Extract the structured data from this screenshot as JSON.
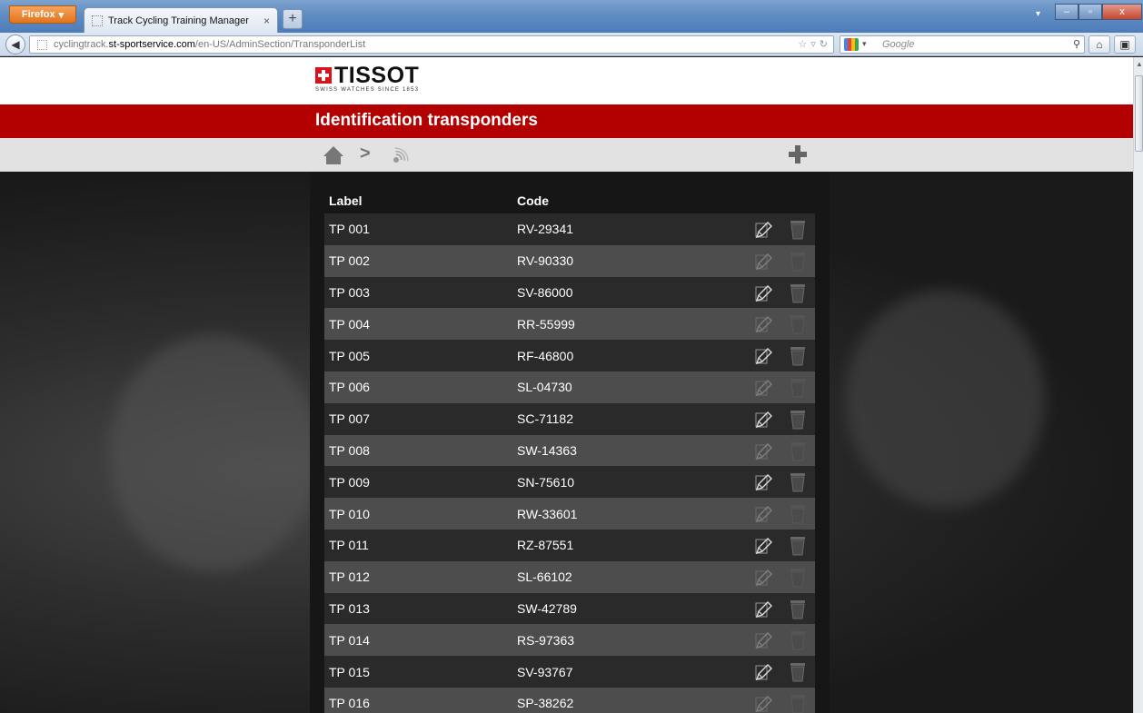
{
  "browser": {
    "app_button": "Firefox",
    "tab_title": "Track Cycling Training Manager",
    "new_tab": "+",
    "url_prefix": "cyclingtrack.",
    "url_host": "st-sportservice.com",
    "url_path": "/en-US/AdminSection/TransponderList",
    "search_placeholder": "Google",
    "window_min": "–",
    "window_max": "▫",
    "window_close": "x"
  },
  "header": {
    "logo_word": "TISSOT",
    "logo_tagline": "SWISS WATCHES SINCE 1853",
    "page_title": "Identification transponders",
    "breadcrumb_separator": ">"
  },
  "table": {
    "columns": {
      "label": "Label",
      "code": "Code"
    },
    "rows": [
      {
        "label": "TP 001",
        "code": "RV-29341"
      },
      {
        "label": "TP 002",
        "code": "RV-90330"
      },
      {
        "label": "TP 003",
        "code": "SV-86000"
      },
      {
        "label": "TP 004",
        "code": "RR-55999"
      },
      {
        "label": "TP 005",
        "code": "RF-46800"
      },
      {
        "label": "TP 006",
        "code": "SL-04730"
      },
      {
        "label": "TP 007",
        "code": "SC-71182"
      },
      {
        "label": "TP 008",
        "code": "SW-14363"
      },
      {
        "label": "TP 009",
        "code": "SN-75610"
      },
      {
        "label": "TP 010",
        "code": "RW-33601"
      },
      {
        "label": "TP 011",
        "code": "RZ-87551"
      },
      {
        "label": "TP 012",
        "code": "SL-66102"
      },
      {
        "label": "TP 013",
        "code": "SW-42789"
      },
      {
        "label": "TP 014",
        "code": "RS-97363"
      },
      {
        "label": "TP 015",
        "code": "SV-93767"
      },
      {
        "label": "TP 016",
        "code": "SP-38262"
      }
    ]
  },
  "colors": {
    "brand_red": "#b30000",
    "toolbar_gray": "#e2e2e2",
    "row_dark": "#2a2a2a",
    "row_light": "#4d4d4d"
  },
  "icons": {
    "breadcrumb_home": "home-icon",
    "breadcrumb_current": "transponder-icon",
    "add": "plus-icon",
    "row_edit": "edit-pencil-icon",
    "row_delete": "trash-icon"
  }
}
